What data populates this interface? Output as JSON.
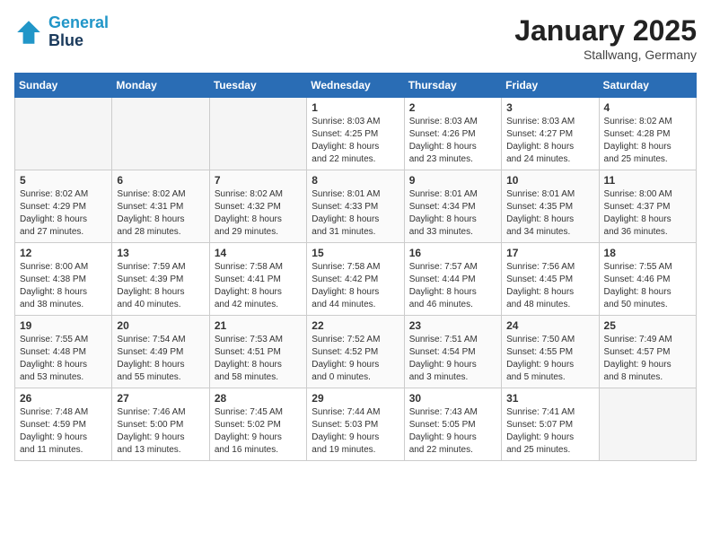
{
  "header": {
    "logo_line1": "General",
    "logo_line2": "Blue",
    "month_year": "January 2025",
    "location": "Stallwang, Germany"
  },
  "weekdays": [
    "Sunday",
    "Monday",
    "Tuesday",
    "Wednesday",
    "Thursday",
    "Friday",
    "Saturday"
  ],
  "weeks": [
    [
      {
        "day": "",
        "info": ""
      },
      {
        "day": "",
        "info": ""
      },
      {
        "day": "",
        "info": ""
      },
      {
        "day": "1",
        "info": "Sunrise: 8:03 AM\nSunset: 4:25 PM\nDaylight: 8 hours\nand 22 minutes."
      },
      {
        "day": "2",
        "info": "Sunrise: 8:03 AM\nSunset: 4:26 PM\nDaylight: 8 hours\nand 23 minutes."
      },
      {
        "day": "3",
        "info": "Sunrise: 8:03 AM\nSunset: 4:27 PM\nDaylight: 8 hours\nand 24 minutes."
      },
      {
        "day": "4",
        "info": "Sunrise: 8:02 AM\nSunset: 4:28 PM\nDaylight: 8 hours\nand 25 minutes."
      }
    ],
    [
      {
        "day": "5",
        "info": "Sunrise: 8:02 AM\nSunset: 4:29 PM\nDaylight: 8 hours\nand 27 minutes."
      },
      {
        "day": "6",
        "info": "Sunrise: 8:02 AM\nSunset: 4:31 PM\nDaylight: 8 hours\nand 28 minutes."
      },
      {
        "day": "7",
        "info": "Sunrise: 8:02 AM\nSunset: 4:32 PM\nDaylight: 8 hours\nand 29 minutes."
      },
      {
        "day": "8",
        "info": "Sunrise: 8:01 AM\nSunset: 4:33 PM\nDaylight: 8 hours\nand 31 minutes."
      },
      {
        "day": "9",
        "info": "Sunrise: 8:01 AM\nSunset: 4:34 PM\nDaylight: 8 hours\nand 33 minutes."
      },
      {
        "day": "10",
        "info": "Sunrise: 8:01 AM\nSunset: 4:35 PM\nDaylight: 8 hours\nand 34 minutes."
      },
      {
        "day": "11",
        "info": "Sunrise: 8:00 AM\nSunset: 4:37 PM\nDaylight: 8 hours\nand 36 minutes."
      }
    ],
    [
      {
        "day": "12",
        "info": "Sunrise: 8:00 AM\nSunset: 4:38 PM\nDaylight: 8 hours\nand 38 minutes."
      },
      {
        "day": "13",
        "info": "Sunrise: 7:59 AM\nSunset: 4:39 PM\nDaylight: 8 hours\nand 40 minutes."
      },
      {
        "day": "14",
        "info": "Sunrise: 7:58 AM\nSunset: 4:41 PM\nDaylight: 8 hours\nand 42 minutes."
      },
      {
        "day": "15",
        "info": "Sunrise: 7:58 AM\nSunset: 4:42 PM\nDaylight: 8 hours\nand 44 minutes."
      },
      {
        "day": "16",
        "info": "Sunrise: 7:57 AM\nSunset: 4:44 PM\nDaylight: 8 hours\nand 46 minutes."
      },
      {
        "day": "17",
        "info": "Sunrise: 7:56 AM\nSunset: 4:45 PM\nDaylight: 8 hours\nand 48 minutes."
      },
      {
        "day": "18",
        "info": "Sunrise: 7:55 AM\nSunset: 4:46 PM\nDaylight: 8 hours\nand 50 minutes."
      }
    ],
    [
      {
        "day": "19",
        "info": "Sunrise: 7:55 AM\nSunset: 4:48 PM\nDaylight: 8 hours\nand 53 minutes."
      },
      {
        "day": "20",
        "info": "Sunrise: 7:54 AM\nSunset: 4:49 PM\nDaylight: 8 hours\nand 55 minutes."
      },
      {
        "day": "21",
        "info": "Sunrise: 7:53 AM\nSunset: 4:51 PM\nDaylight: 8 hours\nand 58 minutes."
      },
      {
        "day": "22",
        "info": "Sunrise: 7:52 AM\nSunset: 4:52 PM\nDaylight: 9 hours\nand 0 minutes."
      },
      {
        "day": "23",
        "info": "Sunrise: 7:51 AM\nSunset: 4:54 PM\nDaylight: 9 hours\nand 3 minutes."
      },
      {
        "day": "24",
        "info": "Sunrise: 7:50 AM\nSunset: 4:55 PM\nDaylight: 9 hours\nand 5 minutes."
      },
      {
        "day": "25",
        "info": "Sunrise: 7:49 AM\nSunset: 4:57 PM\nDaylight: 9 hours\nand 8 minutes."
      }
    ],
    [
      {
        "day": "26",
        "info": "Sunrise: 7:48 AM\nSunset: 4:59 PM\nDaylight: 9 hours\nand 11 minutes."
      },
      {
        "day": "27",
        "info": "Sunrise: 7:46 AM\nSunset: 5:00 PM\nDaylight: 9 hours\nand 13 minutes."
      },
      {
        "day": "28",
        "info": "Sunrise: 7:45 AM\nSunset: 5:02 PM\nDaylight: 9 hours\nand 16 minutes."
      },
      {
        "day": "29",
        "info": "Sunrise: 7:44 AM\nSunset: 5:03 PM\nDaylight: 9 hours\nand 19 minutes."
      },
      {
        "day": "30",
        "info": "Sunrise: 7:43 AM\nSunset: 5:05 PM\nDaylight: 9 hours\nand 22 minutes."
      },
      {
        "day": "31",
        "info": "Sunrise: 7:41 AM\nSunset: 5:07 PM\nDaylight: 9 hours\nand 25 minutes."
      },
      {
        "day": "",
        "info": ""
      }
    ]
  ]
}
